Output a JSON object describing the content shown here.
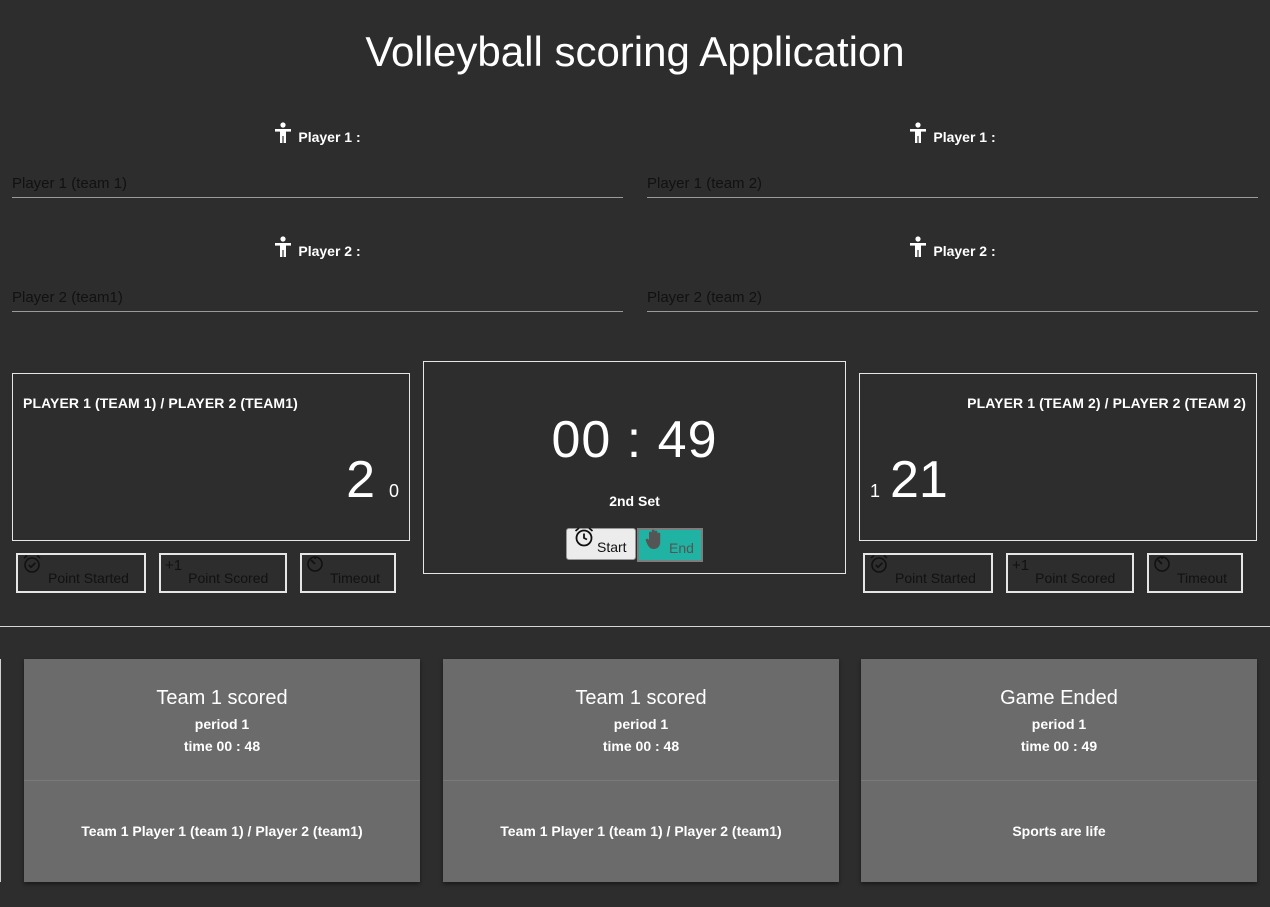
{
  "app": {
    "title": "Volleyball scoring Application"
  },
  "players": {
    "team1": [
      {
        "label": "Player 1 :",
        "placeholder": "Player 1 (team 1)",
        "icon": "person-icon"
      },
      {
        "label": "Player 2 :",
        "placeholder": "Player 2 (team1)",
        "icon": "person-icon"
      }
    ],
    "team2": [
      {
        "label": "Player 1 :",
        "placeholder": "Player 1 (team 2)",
        "icon": "person-icon"
      },
      {
        "label": "Player 2 :",
        "placeholder": "Player 2 (team 2)",
        "icon": "person-icon"
      }
    ]
  },
  "scoreboard": {
    "team1": {
      "name": "Player 1 (team 1) / Player 2 (team1)",
      "points": "2",
      "sets": "0"
    },
    "team2": {
      "name": "Player 1 (team 2) / Player 2 (team 2)",
      "points": "21",
      "sets": "1"
    }
  },
  "actions": {
    "point_started": "Point Started",
    "point_scored": "Point Scored",
    "point_scored_icon_text": "+1",
    "timeout": "Timeout"
  },
  "timer": {
    "minutes": "00",
    "separator": ":",
    "seconds": "49",
    "set_label": "2nd Set",
    "start_label": "Start",
    "end_label": "End"
  },
  "events": [
    {
      "title": "Team 1 scored",
      "period": "period 1",
      "time": "time 00 : 48",
      "detail": "Team 1 Player 1 (team 1) / Player 2 (team1)"
    },
    {
      "title": "Team 1 scored",
      "period": "period 1",
      "time": "time 00 : 48",
      "detail": "Team 1 Player 1 (team 1) / Player 2 (team1)"
    },
    {
      "title": "Game Ended",
      "period": "period 1",
      "time": "time 00 : 49",
      "detail": "Sports are life"
    }
  ],
  "colors": {
    "background": "#2d2d2d",
    "card": "#6b6b6b",
    "end_button": "#20b2a2"
  }
}
